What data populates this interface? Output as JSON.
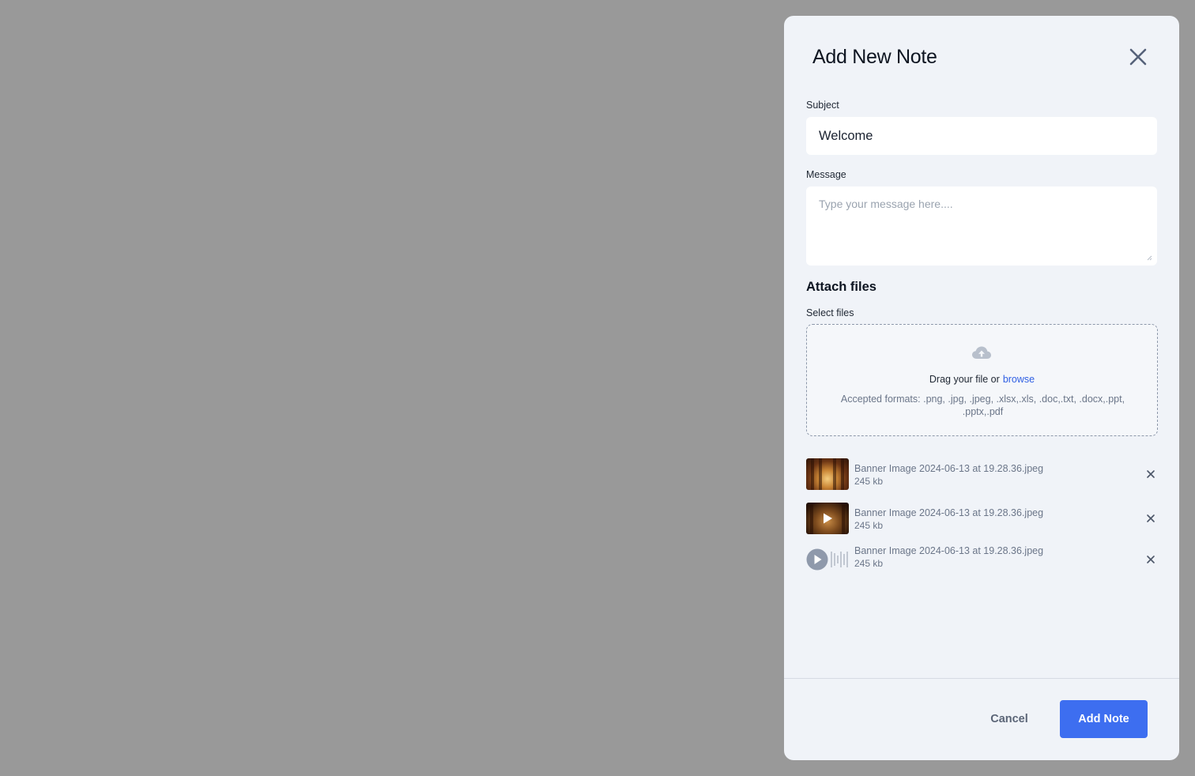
{
  "dialog": {
    "title": "Add New Note",
    "close_icon": "close-icon"
  },
  "subject": {
    "label": "Subject",
    "value": "Welcome"
  },
  "message": {
    "label": "Message",
    "placeholder": "Type your message here...."
  },
  "attach": {
    "heading": "Attach files",
    "select_label": "Select files",
    "upload_icon": "cloud-upload-icon",
    "drag_text": "Drag your file or",
    "browse_text": "browse",
    "formats_text": "Accepted formats: .png, .jpg, .jpeg, .xlsx,.xls, .doc,.txt, .docx,.ppt, .pptx,.pdf"
  },
  "files": [
    {
      "kind": "image",
      "name": "Banner Image 2024-06-13 at 19.28.36.jpeg",
      "size": "245 kb"
    },
    {
      "kind": "video",
      "name": "Banner Image 2024-06-13 at 19.28.36.jpeg",
      "size": "245 kb"
    },
    {
      "kind": "audio",
      "name": "Banner Image 2024-06-13 at 19.28.36.jpeg",
      "size": "245 kb"
    }
  ],
  "footer": {
    "cancel_label": "Cancel",
    "submit_label": "Add Note"
  },
  "colors": {
    "overlay": "#999999",
    "panel": "#f0f3f8",
    "primary": "#3d6ef0",
    "link": "#2f5fe3"
  }
}
